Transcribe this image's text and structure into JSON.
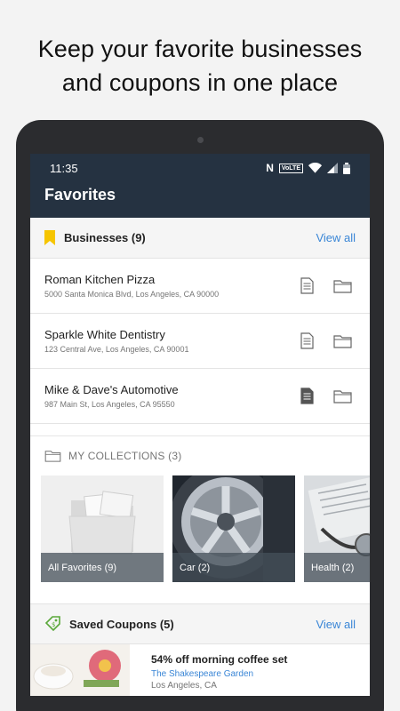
{
  "headline": {
    "line1": "Keep your favorite businesses",
    "line2": "and coupons in one place"
  },
  "status_bar": {
    "time": "11:35",
    "nfc": "N",
    "volte": "VoLTE"
  },
  "app_bar": {
    "title": "Favorites"
  },
  "businesses": {
    "title": "Businesses (9)",
    "view_all": "View all",
    "accent_color": "#f6c500",
    "items": [
      {
        "name": "Roman Kitchen Pizza",
        "address": "5000 Santa Monica Blvd, Los Angeles, CA 90000",
        "doc_filled": false
      },
      {
        "name": "Sparkle White Dentistry",
        "address": "123 Central Ave, Los Angeles, CA 90001",
        "doc_filled": false
      },
      {
        "name": "Mike & Dave's Automotive",
        "address": "987 Main St, Los Angeles, CA 95550",
        "doc_filled": true
      }
    ]
  },
  "collections": {
    "title": "MY COLLECTIONS (3)",
    "tiles": [
      {
        "caption": "All Favorites (9)",
        "image": "folder-photos"
      },
      {
        "caption": "Car (2)",
        "image": "car-wheel"
      },
      {
        "caption": "Health (2)",
        "image": "stethoscope"
      }
    ]
  },
  "saved_coupons": {
    "title": "Saved Coupons (5)",
    "view_all": "View all",
    "items": [
      {
        "title": "54% off morning coffee set",
        "business": "The Shakespeare Garden",
        "location": "Los Angeles, CA",
        "image": "coffee-flowers"
      }
    ]
  },
  "colors": {
    "app_bar": "#253241",
    "link": "#3a86d6"
  }
}
